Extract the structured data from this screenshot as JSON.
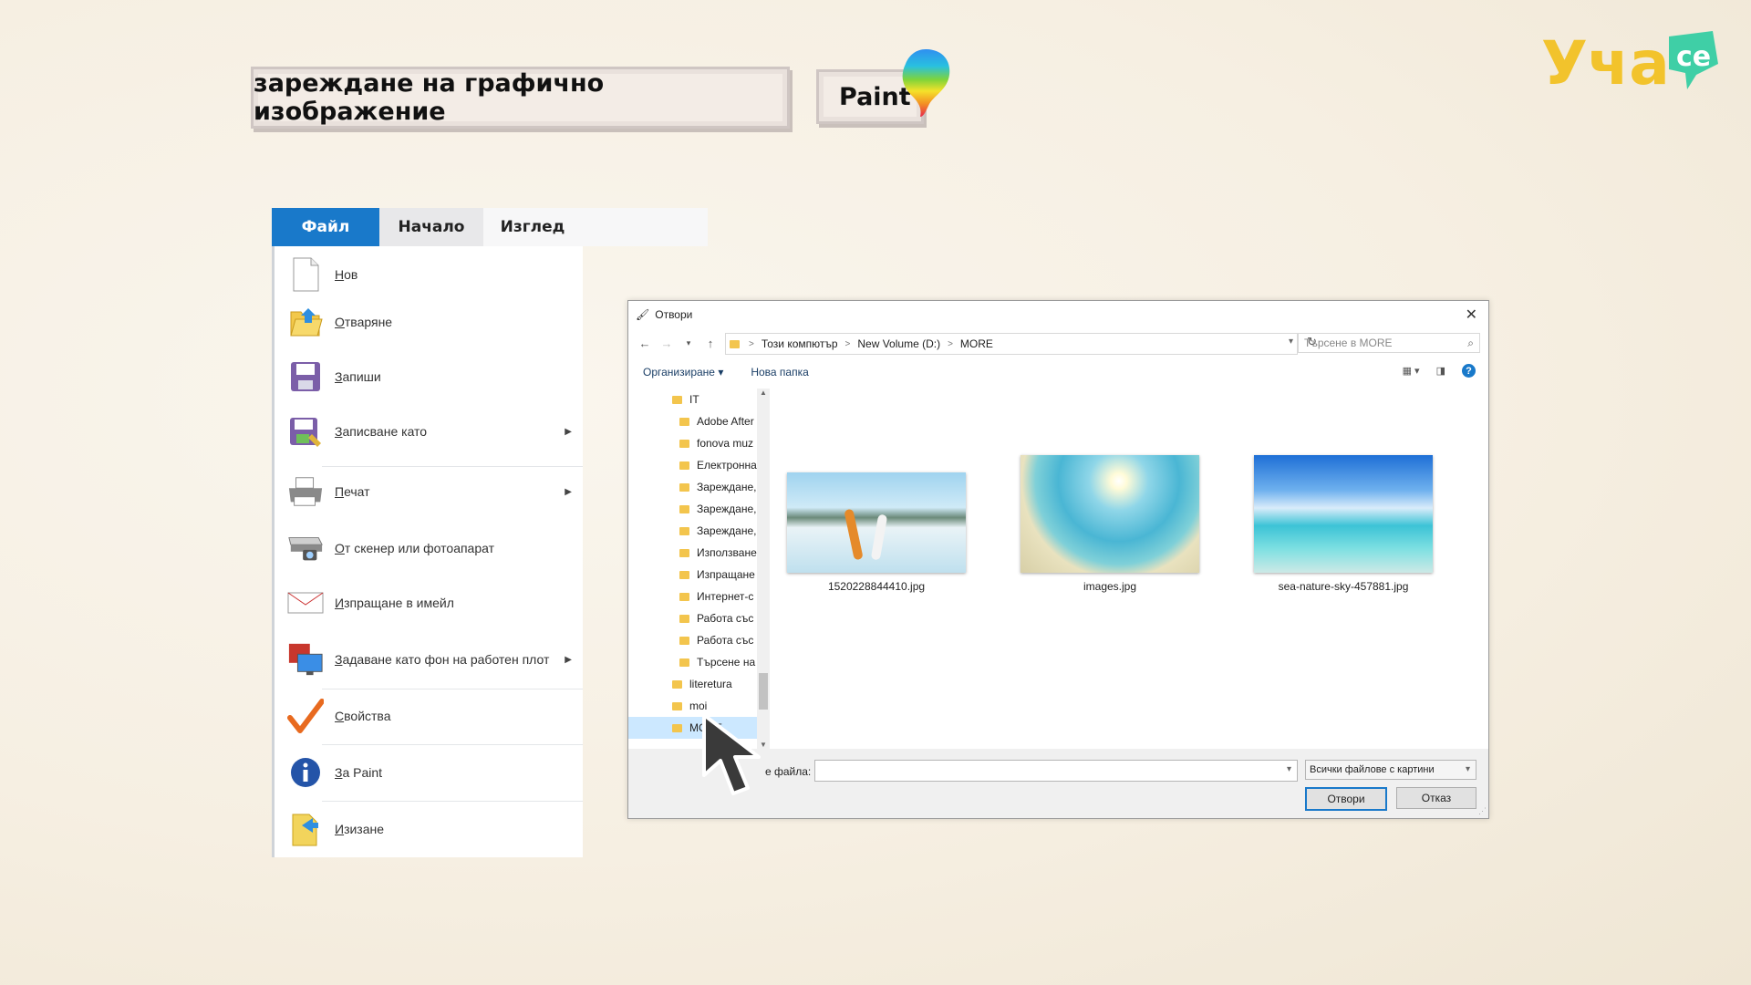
{
  "header": {
    "title": "зареждане на графично изображение",
    "app_name": "Paint",
    "logo_text": "Уча се"
  },
  "paint_menu": {
    "tabs": [
      {
        "label": "Файл",
        "active": true
      },
      {
        "label": "Начало",
        "active": false
      },
      {
        "label": "Изглед",
        "active": false
      }
    ],
    "items": [
      {
        "label": "Нов",
        "icon": "new-file-icon",
        "has_submenu": false
      },
      {
        "label": "Отваряне",
        "icon": "open-folder-icon",
        "has_submenu": false
      },
      {
        "label": "Запиши",
        "icon": "save-icon",
        "has_submenu": false
      },
      {
        "label": "Записване като",
        "icon": "save-as-icon",
        "has_submenu": true
      },
      {
        "label": "Печат",
        "icon": "printer-icon",
        "has_submenu": true
      },
      {
        "label": "От скенер или фотоапарат",
        "icon": "scanner-icon",
        "has_submenu": false
      },
      {
        "label": "Изпращане в имейл",
        "icon": "email-icon",
        "has_submenu": false
      },
      {
        "label": "Задаване като фон на работен плот",
        "icon": "desktop-background-icon",
        "has_submenu": true
      },
      {
        "label": "Свойства",
        "icon": "checkmark-icon",
        "has_submenu": false
      },
      {
        "label": "За Paint",
        "icon": "info-icon",
        "has_submenu": false
      },
      {
        "label": "Изизане",
        "icon": "exit-icon",
        "has_submenu": false
      }
    ]
  },
  "open_dialog": {
    "title": "Отвори",
    "breadcrumb": [
      "Този компютър",
      "New Volume (D:)",
      "MORE"
    ],
    "search_placeholder": "Търсене в MORE",
    "toolbar": {
      "organize": "Организиране ▾",
      "new_folder": "Нова папка"
    },
    "tree": [
      {
        "label": "IT",
        "level": 0,
        "selected": false
      },
      {
        "label": "Adobe After",
        "level": 1,
        "selected": false
      },
      {
        "label": "fonova muz",
        "level": 1,
        "selected": false
      },
      {
        "label": "Електронна",
        "level": 1,
        "selected": false
      },
      {
        "label": "Зареждане,",
        "level": 1,
        "selected": false
      },
      {
        "label": "Зареждане,",
        "level": 1,
        "selected": false
      },
      {
        "label": "Зареждане,",
        "level": 1,
        "selected": false
      },
      {
        "label": "Използване",
        "level": 1,
        "selected": false
      },
      {
        "label": "Изпращане",
        "level": 1,
        "selected": false
      },
      {
        "label": "Интернет-с",
        "level": 1,
        "selected": false
      },
      {
        "label": "Работа със",
        "level": 1,
        "selected": false
      },
      {
        "label": "Работа със",
        "level": 1,
        "selected": false
      },
      {
        "label": "Търсене на",
        "level": 1,
        "selected": false
      },
      {
        "label": "literetura",
        "level": 0,
        "selected": false
      },
      {
        "label": "moi",
        "level": 0,
        "selected": false
      },
      {
        "label": "MORE",
        "level": 0,
        "selected": true
      }
    ],
    "files": [
      {
        "name": "1520228844410.jpg",
        "thumbnail": "surfers-beach"
      },
      {
        "name": "images.jpg",
        "thumbnail": "sunny-beach"
      },
      {
        "name": "sea-nature-sky-457881.jpg",
        "thumbnail": "sea-sky"
      }
    ],
    "filename_label": "е файла:",
    "filename_value": "",
    "filter": "Всички файлове с картини",
    "open_button": "Отвори",
    "cancel_button": "Отказ"
  },
  "colors": {
    "accent_blue": "#1979ca",
    "logo_yellow": "#f2c32c",
    "logo_green": "#3fcfa6"
  }
}
